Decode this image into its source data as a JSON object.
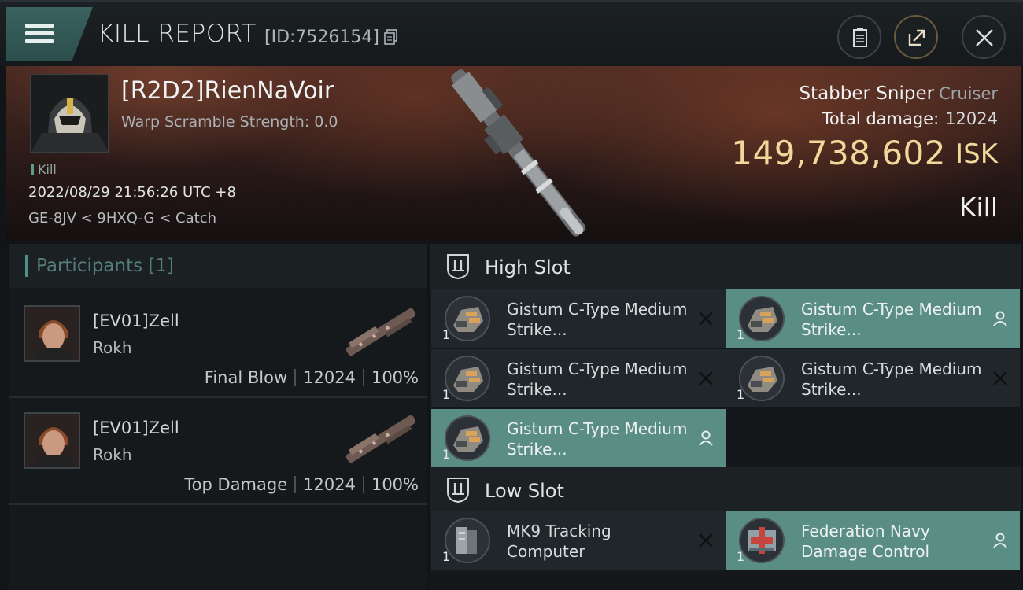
{
  "header": {
    "title": "KILL REPORT",
    "id_label": "[ID:7526154]"
  },
  "victim": {
    "name": "[R2D2]RienNaVoir",
    "warp_scramble": "Warp Scramble Strength: 0.0",
    "tag": "Kill",
    "timestamp": "2022/08/29 21:56:26 UTC +8",
    "location": "GE-8JV < 9HXQ-G < Catch",
    "ship_name": "Stabber Sniper",
    "ship_class": "Cruiser",
    "total_damage_label": "Total damage:",
    "total_damage": "12024",
    "isk_value": "149,738,602",
    "isk_unit": "ISK",
    "result": "Kill"
  },
  "participants": {
    "title": "Participants [1]",
    "rows": [
      {
        "name": "[EV01]Zell",
        "ship": "Rokh",
        "role": "Final Blow",
        "damage": "12024",
        "percent": "100%"
      },
      {
        "name": "[EV01]Zell",
        "ship": "Rokh",
        "role": "Top Damage",
        "damage": "12024",
        "percent": "100%"
      }
    ]
  },
  "slots": {
    "high": {
      "title": "High Slot",
      "items": [
        {
          "name": "Gistum C-Type Medium Strike...",
          "qty": "1",
          "highlight": false,
          "action": "close"
        },
        {
          "name": "Gistum C-Type Medium Strike...",
          "qty": "1",
          "highlight": true,
          "action": "person"
        },
        {
          "name": "Gistum C-Type Medium Strike...",
          "qty": "1",
          "highlight": false,
          "action": "close"
        },
        {
          "name": "Gistum C-Type Medium Strike...",
          "qty": "1",
          "highlight": false,
          "action": "close"
        },
        {
          "name": "Gistum C-Type Medium Strike...",
          "qty": "1",
          "highlight": true,
          "action": "person"
        }
      ]
    },
    "low": {
      "title": "Low Slot",
      "items": [
        {
          "name": "MK9 Tracking Computer",
          "qty": "1",
          "highlight": false,
          "action": "close"
        },
        {
          "name": "Federation Navy Damage Control",
          "qty": "1",
          "highlight": true,
          "action": "person"
        }
      ]
    }
  },
  "colors": {
    "accent_teal": "#5a8d84",
    "isk_gold": "#f2d79a",
    "panel_dark": "#20262a"
  }
}
